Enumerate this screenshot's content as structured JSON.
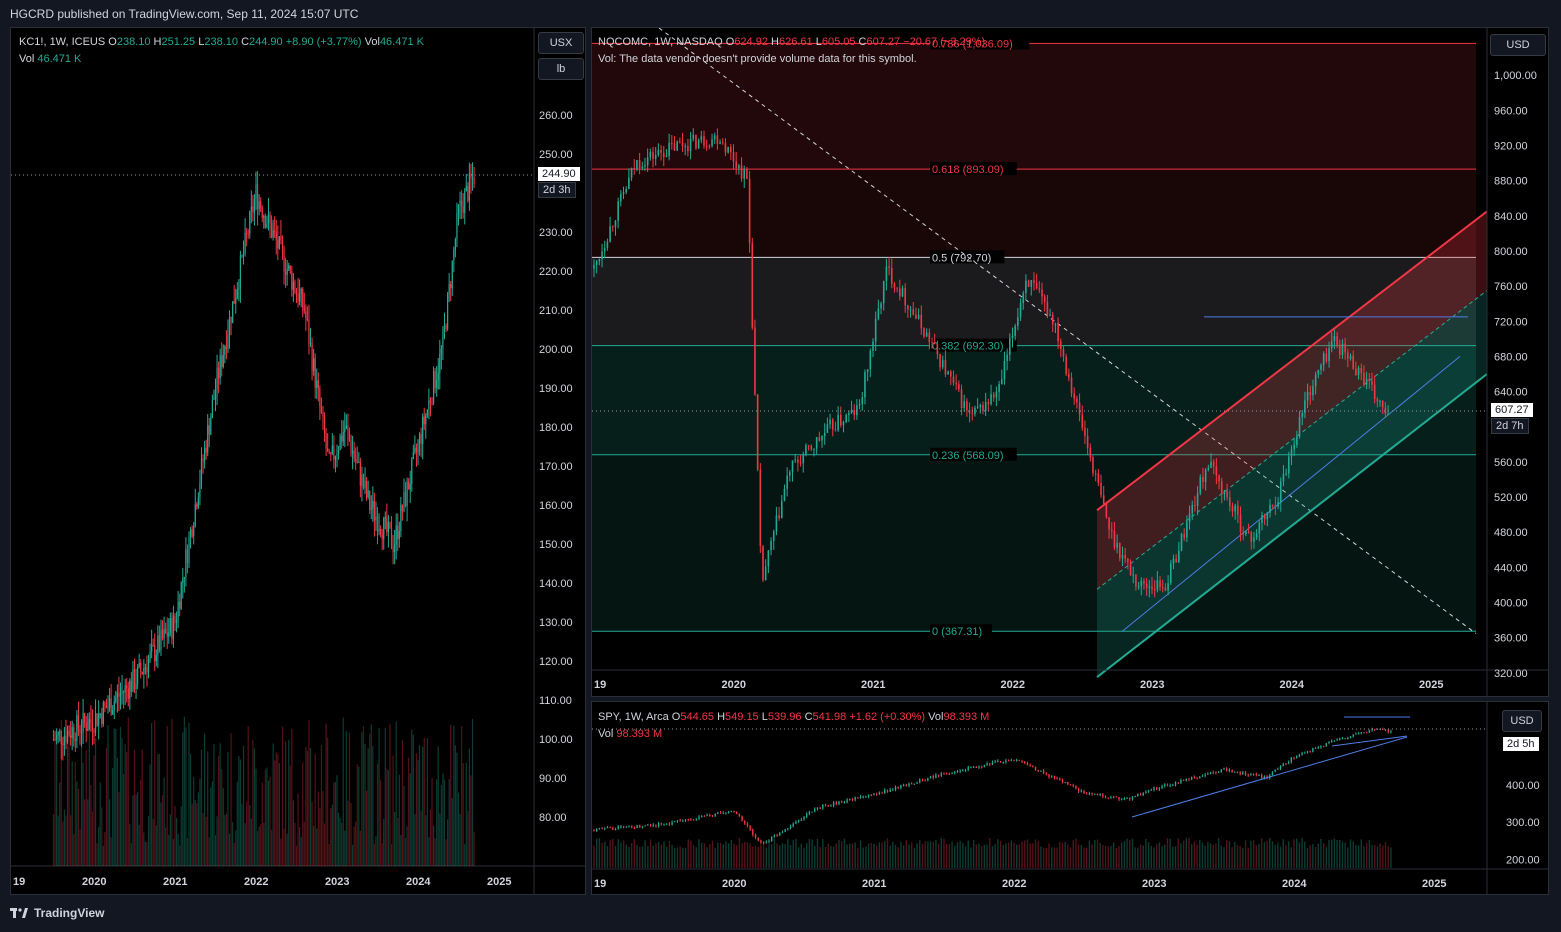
{
  "header": {
    "title": "HGCRD published on TradingView.com, Sep 11, 2024 15:07 UTC"
  },
  "footer": {
    "brand": "TradingView"
  },
  "panel_left": {
    "symbol": "KC1!, 1W, ICEUS",
    "o_label": "O",
    "o": "238.10",
    "h_label": "H",
    "h": "251.25",
    "l_label": "L",
    "l": "238.10",
    "c_label": "C",
    "c": "244.90",
    "change": "+8.90 (+3.77%)",
    "vol_label": "Vol",
    "vol": "46.471 K",
    "vol_row_label": "Vol",
    "vol_row_value": "46.471 K",
    "currency": "USX",
    "unit": "lb",
    "last_price": "244.90",
    "countdown": "2d 3h"
  },
  "panel_main": {
    "symbol": "NQCOMC, 1W, NASDAQ",
    "o_label": "O",
    "o": "624.92",
    "h_label": "H",
    "h": "626.61",
    "l_label": "L",
    "l": "605.05",
    "c_label": "C",
    "c": "607.27",
    "change": "−20.67 (−3.29%)",
    "vol_note": "Vol: The data vendor doesn't provide volume data for this symbol.",
    "currency": "USD",
    "last_price": "607.27",
    "countdown": "2d 7h",
    "fib_labels": [
      "0.786 (1,036.09)",
      "0.618 (893.09)",
      "0.5 (792.70)",
      "0.382 (692.30)",
      "0.236 (568.09)",
      "0 (367.31)"
    ]
  },
  "panel_spy": {
    "symbol": "SPY, 1W, Arca",
    "o_label": "O",
    "o": "544.65",
    "h_label": "H",
    "h": "549.15",
    "l_label": "L",
    "l": "539.96",
    "c_label": "C",
    "c": "541.98",
    "change": "+1.62 (+0.30%)",
    "vol_label": "Vol",
    "vol": "98.393 M",
    "vol_row_label": "Vol",
    "vol_row_value": "98.393 M",
    "currency": "USD",
    "countdown": "2d 5h"
  },
  "chart_data": [
    {
      "type": "candlestick",
      "title": "KC1!, 1W, ICEUS",
      "x_ticks": [
        "19",
        "2020",
        "2021",
        "2022",
        "2023",
        "2024",
        "2025"
      ],
      "y_ticks": [
        "260.00",
        "250.00",
        "230.00",
        "220.00",
        "210.00",
        "200.00",
        "190.00",
        "180.00",
        "170.00",
        "160.00",
        "150.00",
        "140.00",
        "130.00",
        "120.00",
        "110.00",
        "100.00",
        "90.00",
        "80.00"
      ],
      "ylim": [
        70,
        270
      ],
      "series": [
        {
          "x": [
            2019.5,
            2020.0,
            2020.5,
            2021.0,
            2021.5,
            2022.0,
            2022.3,
            2022.6,
            2022.9,
            2023.1,
            2023.4,
            2023.7,
            2024.0,
            2024.3,
            2024.5,
            2024.7
          ],
          "values": [
            100,
            105,
            115,
            130,
            190,
            240,
            225,
            210,
            170,
            180,
            160,
            150,
            175,
            200,
            235,
            244.9
          ]
        }
      ]
    },
    {
      "type": "candlestick",
      "title": "NQCOMC, 1W, NASDAQ",
      "x_ticks": [
        "19",
        "2020",
        "2021",
        "2022",
        "2023",
        "2024",
        "2025"
      ],
      "y_ticks": [
        "1,000.00",
        "960.00",
        "920.00",
        "880.00",
        "840.00",
        "800.00",
        "760.00",
        "720.00",
        "680.00",
        "640.00",
        "600.00",
        "560.00",
        "520.00",
        "480.00",
        "440.00",
        "400.00",
        "360.00",
        "320.00"
      ],
      "ylim": [
        305,
        1040
      ],
      "fib_levels": [
        1036.09,
        893.09,
        792.7,
        692.3,
        568.09,
        367.31
      ],
      "series": [
        {
          "x": [
            2019.0,
            2019.3,
            2019.6,
            2019.9,
            2020.1,
            2020.2,
            2020.4,
            2020.7,
            2020.9,
            2021.1,
            2021.4,
            2021.7,
            2021.9,
            2022.1,
            2022.3,
            2022.5,
            2022.7,
            2022.9,
            2023.1,
            2023.4,
            2023.7,
            2023.9,
            2024.1,
            2024.3,
            2024.5,
            2024.7
          ],
          "values": [
            780,
            900,
            920,
            930,
            880,
            420,
            550,
            600,
            620,
            780,
            700,
            610,
            640,
            770,
            720,
            600,
            480,
            420,
            420,
            560,
            470,
            520,
            630,
            700,
            660,
            607.27
          ]
        }
      ]
    },
    {
      "type": "candlestick",
      "title": "SPY, 1W, Arca",
      "x_ticks": [
        "19",
        "2020",
        "2021",
        "2022",
        "2023",
        "2024",
        "2025"
      ],
      "y_ticks": [
        "400.00",
        "300.00",
        "200.00"
      ],
      "ylim": [
        180,
        590
      ],
      "series": [
        {
          "x": [
            2019.0,
            2019.5,
            2020.0,
            2020.2,
            2020.6,
            2021.0,
            2021.5,
            2022.0,
            2022.5,
            2022.8,
            2023.0,
            2023.5,
            2023.8,
            2024.0,
            2024.3,
            2024.6,
            2024.7
          ],
          "values": [
            280,
            295,
            330,
            240,
            340,
            375,
            430,
            470,
            380,
            360,
            390,
            440,
            420,
            475,
            520,
            550,
            541.98
          ]
        }
      ]
    }
  ]
}
